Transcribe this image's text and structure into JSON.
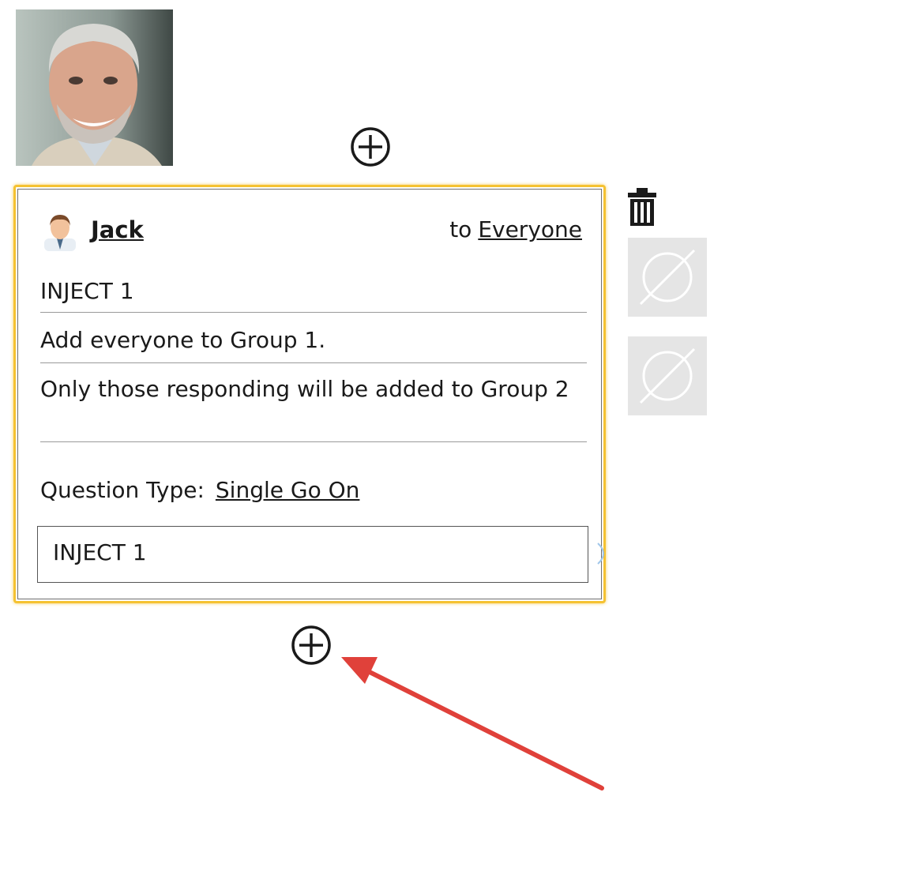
{
  "profile_photo": {
    "icon": "person-photo"
  },
  "card": {
    "sender_name": "Jack",
    "to_prefix": "to",
    "recipient": "Everyone",
    "title": "INJECT 1",
    "line1": "Add everyone to Group 1.",
    "line2": "Only those responding will be added to Group 2",
    "question_type_label": "Question Type:",
    "question_type_value": "Single Go On",
    "inject_input_value": "INJECT 1",
    "border_color": "#f5c232"
  },
  "icons": {
    "add_top": "plus-circle-icon",
    "add_bottom": "plus-circle-icon",
    "delete": "trash-icon",
    "empty_slots": [
      "empty-set-icon",
      "empty-set-icon"
    ]
  },
  "annotation": {
    "arrow_color": "#e0413a"
  }
}
